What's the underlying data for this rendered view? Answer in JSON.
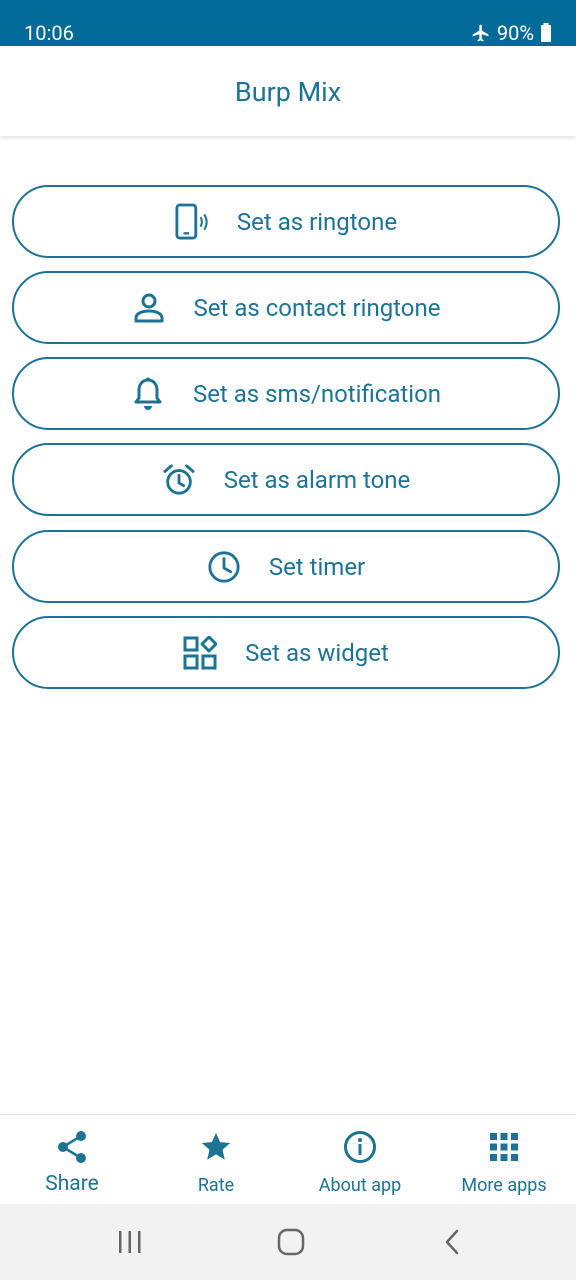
{
  "status_bar": {
    "time": "10:06",
    "battery": "90%",
    "airplane_icon": "airplane-icon",
    "battery_icon": "battery-icon"
  },
  "app_bar": {
    "title": "Burp Mix"
  },
  "actions": [
    {
      "label": "Set as ringtone",
      "icon": "phone-vibrate-icon"
    },
    {
      "label": "Set as contact ringtone",
      "icon": "person-icon"
    },
    {
      "label": "Set as sms/notification",
      "icon": "bell-icon"
    },
    {
      "label": "Set as alarm tone",
      "icon": "alarm-clock-icon"
    },
    {
      "label": "Set timer",
      "icon": "clock-icon"
    },
    {
      "label": "Set as widget",
      "icon": "widgets-icon"
    }
  ],
  "bottom_nav": [
    {
      "label": "Share",
      "icon": "share-icon"
    },
    {
      "label": "Rate",
      "icon": "star-icon"
    },
    {
      "label": "About app",
      "icon": "info-icon"
    },
    {
      "label": "More apps",
      "icon": "apps-grid-icon"
    }
  ],
  "colors": {
    "accent": "#1d7396",
    "status_bar": "#036b98"
  }
}
